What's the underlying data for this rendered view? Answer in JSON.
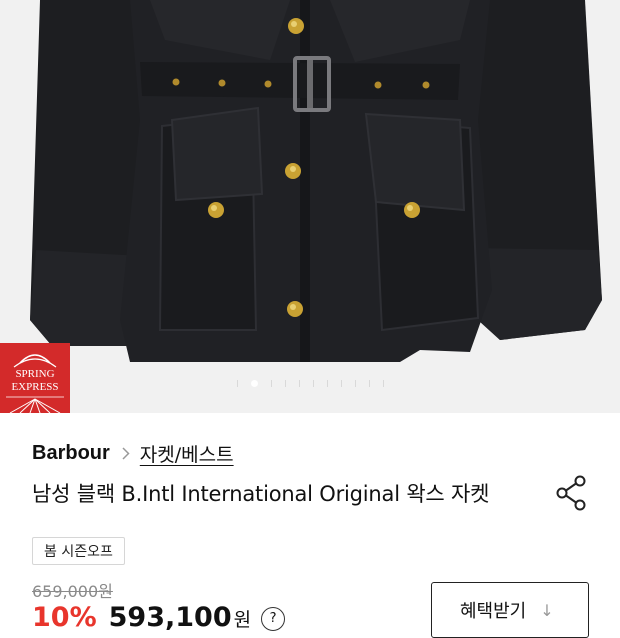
{
  "product_image": {
    "badge_text_line1": "SPRING",
    "badge_text_line2": "EXPRESS",
    "slide_count": 11,
    "active_slide": 2
  },
  "breadcrumb": {
    "brand": "Barbour",
    "category": "자켓/베스트",
    "separator_icon": "chevron-right-icon"
  },
  "product": {
    "title": "남성 블랙 B.Intl International Original 왁스 자켓",
    "tag": "봄 시즌오프",
    "original_price": "659,000원",
    "discount": "10%",
    "sale_price": "593,100",
    "currency": "원",
    "price_info_icon": "?"
  },
  "actions": {
    "share_icon": "share-icon",
    "benefit_button": "혜택받기",
    "benefit_arrow": "↓"
  },
  "colors": {
    "badge_red": "#d32a2a",
    "discount_red": "#e8352c",
    "jacket": "#1e1f22",
    "button_gold": "#c9a233"
  }
}
